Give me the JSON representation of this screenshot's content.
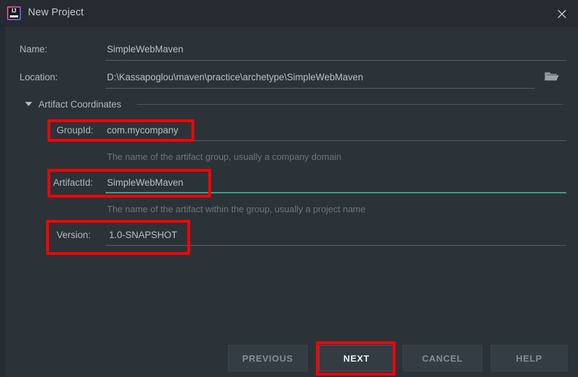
{
  "window": {
    "title": "New Project",
    "app_icon": "intellij-idea-icon",
    "icon_letters": "IJ",
    "close_icon": "close-icon",
    "bg_color": "#2b3339",
    "titlebar_color": "#252b31"
  },
  "fields": {
    "name": {
      "label": "Name:",
      "value": "SimpleWebMaven",
      "focused": false
    },
    "location": {
      "label": "Location:",
      "value": "D:\\Kassapoglou\\maven\\practice\\archetype\\SimpleWebMaven",
      "focused": false,
      "browse_icon": "folder-open-icon"
    }
  },
  "section": {
    "title": "Artifact Coordinates",
    "expanded": true,
    "toggle_icon": "chevron-down-icon"
  },
  "coordinates": {
    "group_id": {
      "label": "GroupId:",
      "value": "com.mycompany",
      "hint": "The name of the artifact group, usually a company domain",
      "focused": false
    },
    "artifact_id": {
      "label": "ArtifactId:",
      "value": "SimpleWebMaven",
      "hint": "The name of the artifact within the group, usually a project name",
      "focused": true
    },
    "version": {
      "label": "Version:",
      "value": "1.0-SNAPSHOT",
      "hint": "",
      "focused": false
    }
  },
  "buttons": {
    "previous": "PREVIOUS",
    "next": "NEXT",
    "cancel": "CANCEL",
    "help": "HELP"
  },
  "annotations": {
    "color": "#ff0000",
    "targets": [
      "GroupId field",
      "ArtifactId field",
      "Version field",
      "NEXT button"
    ]
  }
}
